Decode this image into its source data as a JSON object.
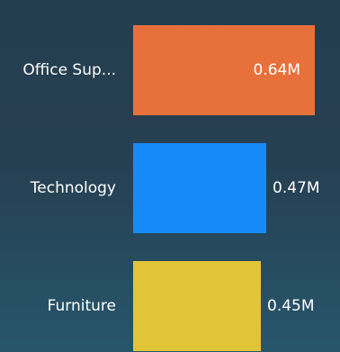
{
  "chart_data": {
    "type": "bar",
    "orientation": "horizontal",
    "title": "",
    "xlabel": "",
    "ylabel": "",
    "categories": [
      "Office Sup...",
      "Technology",
      "Furniture"
    ],
    "values": [
      0.64,
      0.47,
      0.45
    ],
    "value_labels": [
      "0.64M",
      "0.47M",
      "0.45M"
    ],
    "unit": "M",
    "xlim": [
      0,
      0.64
    ],
    "grid": false,
    "legend": "none",
    "colors": [
      "#e8703a",
      "#168af9",
      "#e2c438"
    ],
    "label_color": "#ffffff"
  }
}
